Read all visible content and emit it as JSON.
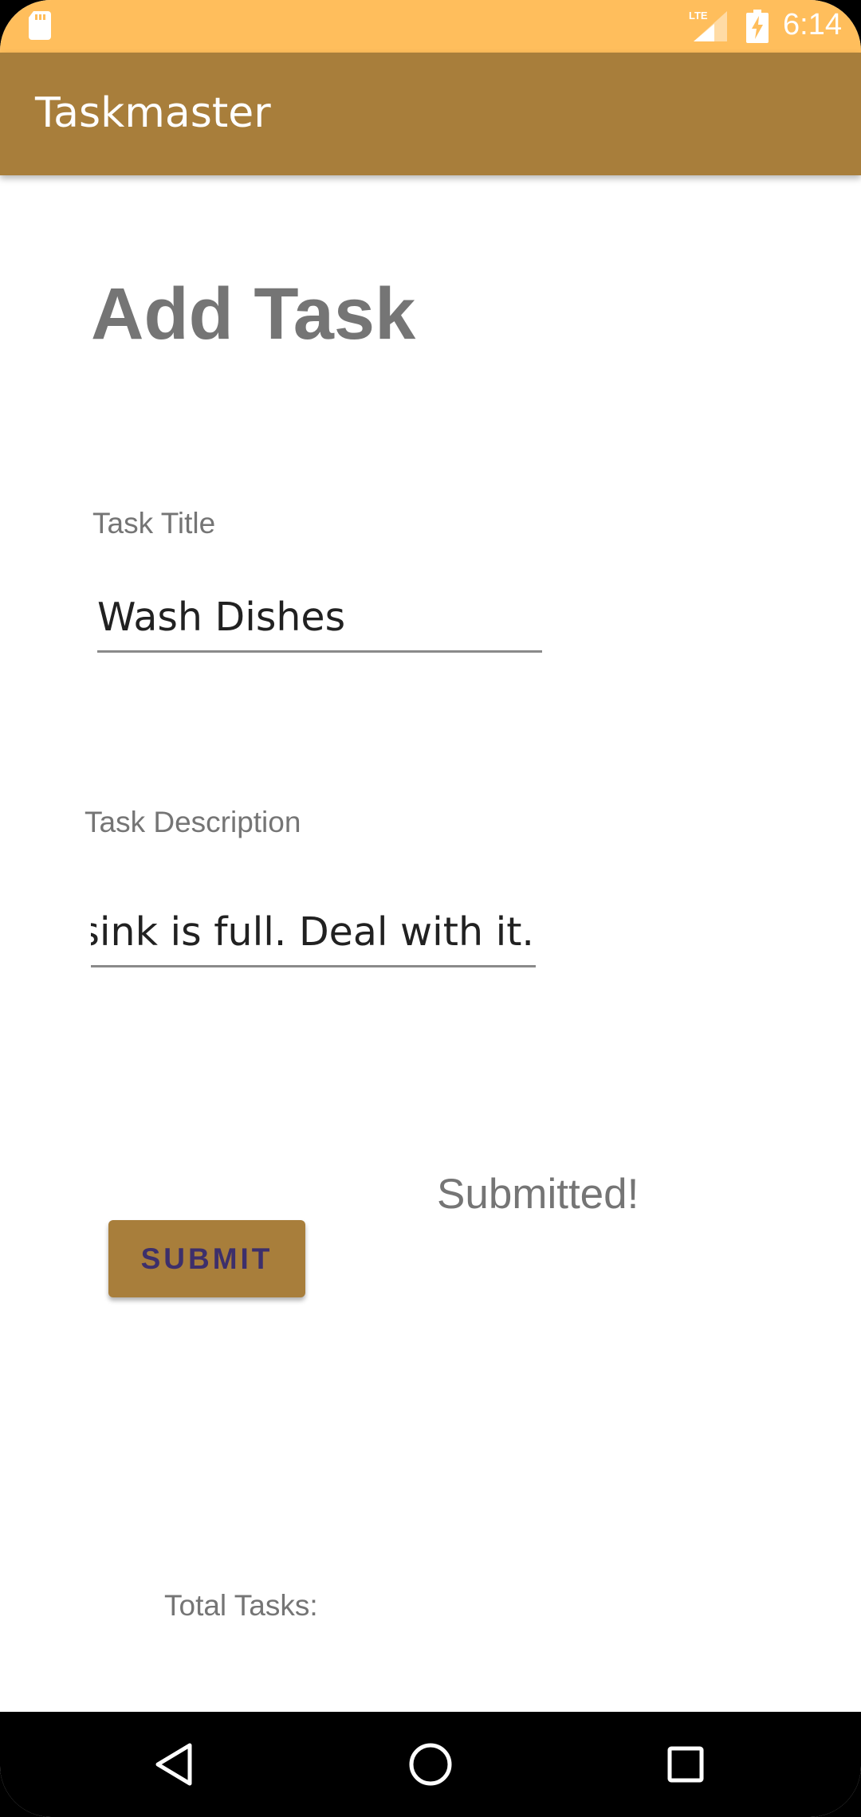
{
  "status_bar": {
    "time": "6:14",
    "network": "LTE",
    "color": "#FFBE5C"
  },
  "app_bar": {
    "title": "Taskmaster",
    "color": "#A87E3B"
  },
  "form": {
    "heading": "Add Task",
    "title_label": "Task Title",
    "title_value": "Wash Dishes",
    "description_label": "Task Description",
    "description_value": "ne sink is full. Deal with it.",
    "submit_label": "SUBMIT",
    "submit_color": "#A87E3B"
  },
  "status_message": "Submitted!",
  "total_tasks_label": "Total Tasks:",
  "nav_bar": {
    "back_icon": "back-triangle-icon",
    "home_icon": "home-circle-icon",
    "recents_icon": "recents-square-icon"
  }
}
